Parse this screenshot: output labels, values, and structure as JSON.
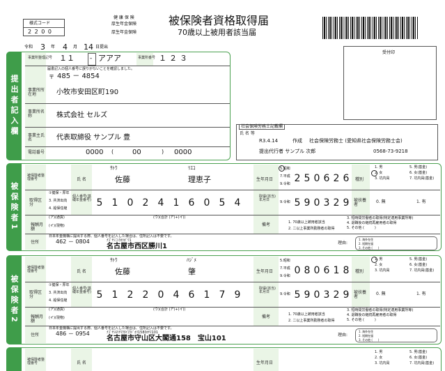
{
  "header": {
    "form_code_label": "様式コード",
    "form_code": "2 2 0 0",
    "ins_types": [
      "健 康 保 険",
      "厚生年金保険",
      "厚生年金保険"
    ],
    "title": "被保険者資格取得届",
    "subtitle": "70歳以上被用者該当届",
    "receipt_label": "受付印"
  },
  "submission": {
    "era": "令和",
    "year": "3",
    "year_unit": "年",
    "month": "4",
    "month_unit": "月",
    "day": "14",
    "day_unit": "日提出",
    "office_code_label": "事業所整理記号",
    "office_code_1": "１１",
    "office_code_2": "アアア",
    "office_no_label": "事業所番号",
    "office_no": "１２３"
  },
  "submitter": {
    "side_label": "提出者記入欄",
    "note": "届書記入の個人番号に誤りがないことを確認しました。",
    "zip_mark": "〒",
    "zip": "485  －  4854",
    "address_label": "事業所所在地",
    "address": "小牧市安田区町190",
    "name_label": "事業所名称",
    "name": "株式会社 セルズ",
    "owner_label": "事業主氏名",
    "owner": "代表取締役 サンプル 豊",
    "phone_label": "電話番号",
    "phone_1": "0000",
    "phone_2": "00",
    "phone_3": "0000"
  },
  "agent": {
    "box_label": "社会保険労務士記載欄",
    "name_label": "氏 名 等",
    "date": "R3.4.14",
    "created": "作成",
    "office": "社会保険労務士 (愛知県社会保険労務士会)",
    "agent_line": "提出代行者 サンプル 次郎",
    "phone": "0568-73-9218"
  },
  "insured": [
    {
      "side_label": "被保険者1",
      "num_label": "被保険者整理番号",
      "name_label": "氏 名",
      "furigana_sei": "ｻﾄｳ",
      "furigana_mei": "ﾘｴｺ",
      "sei": "佐藤",
      "mei": "理恵子",
      "birth_label": "生年月日",
      "era_options": [
        "5.昭和",
        "7.平成",
        "9.令和"
      ],
      "birth_digits": [
        "2",
        "5",
        "0",
        "6",
        "2",
        "6"
      ],
      "gender_label": "種別",
      "gender_options": [
        "1. 男",
        "2. 女",
        "3. 坑内員",
        "5. 男(基金)",
        "6. 女(基金)",
        "7. 坑内員(基金)"
      ],
      "kind_label": "取得区分",
      "kind_options": [
        "①健保・厚年",
        "3. 共済出向",
        "4. 船保任継"
      ],
      "mynum_label": "個人番号(基礎年金番号)",
      "mynum_digits": [
        "5",
        "1",
        "0",
        "2",
        "4",
        "1",
        "6",
        "0",
        "5",
        "4"
      ],
      "acq_label": "取得(該当)年月日",
      "acq_era": "9.令和",
      "acq_digits": [
        "5",
        "9",
        "0",
        "3",
        "2",
        "9"
      ],
      "dep_label": "被扶養者",
      "dep_options": [
        "0. 無",
        "1. 有"
      ],
      "pay_label": "報酬月額",
      "pay_a": "(ア)(通貨)",
      "pay_b": "(イ)(現物)",
      "pay_total": "(ウ)(合計 (ア)+(イ))",
      "note_label": "備考",
      "note_items": [
        "1. 70歳以上被用者該当",
        "2. 二以上事業所勤務者の取得",
        "3. 短時間労働者の取得(特定適用事業所等)",
        "4. 退職後の継続再雇用者の取得",
        "5. その他 (　　　)"
      ],
      "address_label": "住所",
      "address_note": "日本年金機構に提出する際、個人番号を記入した場合は、住所記入は不要です。",
      "zip": "462  －  0804",
      "address_kana": "ﾅｺﾞﾔｼﾆｼｸｶﾂｶﾞﾜ1",
      "address": "名古屋市西区勝川1",
      "reason_label": "理由:",
      "reason_options": [
        "1. 海外在住",
        "2. 短期在留",
        "3. その他 (　　)"
      ]
    },
    {
      "side_label": "被保険者2",
      "num_label": "被保険者整理番号",
      "name_label": "氏 名",
      "furigana_sei": "ｻﾄｳ",
      "furigana_mei": "ﾊｼﾞﾒ",
      "sei": "佐藤",
      "mei": "肇",
      "birth_label": "生年月日",
      "era_options": [
        "5.昭和",
        "7.平成",
        "9.令和"
      ],
      "birth_digits": [
        "0",
        "8",
        "0",
        "6",
        "1",
        "8"
      ],
      "gender_label": "種別",
      "gender_options": [
        "1. 男",
        "2. 女",
        "3. 坑内員",
        "5. 男(基金)",
        "6. 女(基金)",
        "7. 坑内員(基金)"
      ],
      "kind_label": "取得区分",
      "kind_options": [
        "①健保・厚年",
        "3. 共済出向",
        "4. 船保任継"
      ],
      "mynum_label": "個人番号(基礎年金番号)",
      "mynum_digits": [
        "5",
        "1",
        "2",
        "2",
        "0",
        "4",
        "6",
        "1",
        "7",
        "9"
      ],
      "acq_label": "取得(該当)年月日",
      "acq_era": "9.令和",
      "acq_digits": [
        "5",
        "9",
        "0",
        "3",
        "2",
        "9"
      ],
      "dep_label": "被扶養者",
      "dep_options": [
        "0. 無",
        "1. 有"
      ],
      "pay_label": "報酬月額",
      "pay_a": "(ア)(通貨)",
      "pay_b": "(イ)(現物)",
      "pay_total": "(ウ)(合計 (ア)+(イ))",
      "note_label": "備考",
      "note_items": [
        "1. 70歳以上被用者該当",
        "2. 二以上事業所勤務者の取得",
        "3. 短時間労働者の取得(特定適用事業所等)",
        "4. 退職後の継続再雇用者の取得",
        "5. その他 (　　　)"
      ],
      "address_label": "住所",
      "address_note": "日本年金機構に提出する際、個人番号を記入した場合は、住所記入は不要です。",
      "zip": "486  －  0954",
      "address_kana": "ﾅｺﾞﾔｼﾓﾘﾔﾏｸﾀｲｺｳﾄﾞｵﾘ158ﾀｶﾔﾏ101",
      "address": "名古屋市守山区大閣通158　宝山101",
      "reason_label": "理由:",
      "reason_options": [
        "1. 海外在住",
        "2. 短期在留",
        "3. その他 (　　)"
      ]
    }
  ],
  "insured3": {
    "num_label": "被保険者整理番号",
    "name_label": "氏 名",
    "birth_label": "生年月日",
    "gender_options": [
      "1. 男",
      "2. 女",
      "3. 坑内員",
      "5. 男(基金)",
      "6. 女(基金)",
      "7. 坑内員(基金)"
    ]
  }
}
